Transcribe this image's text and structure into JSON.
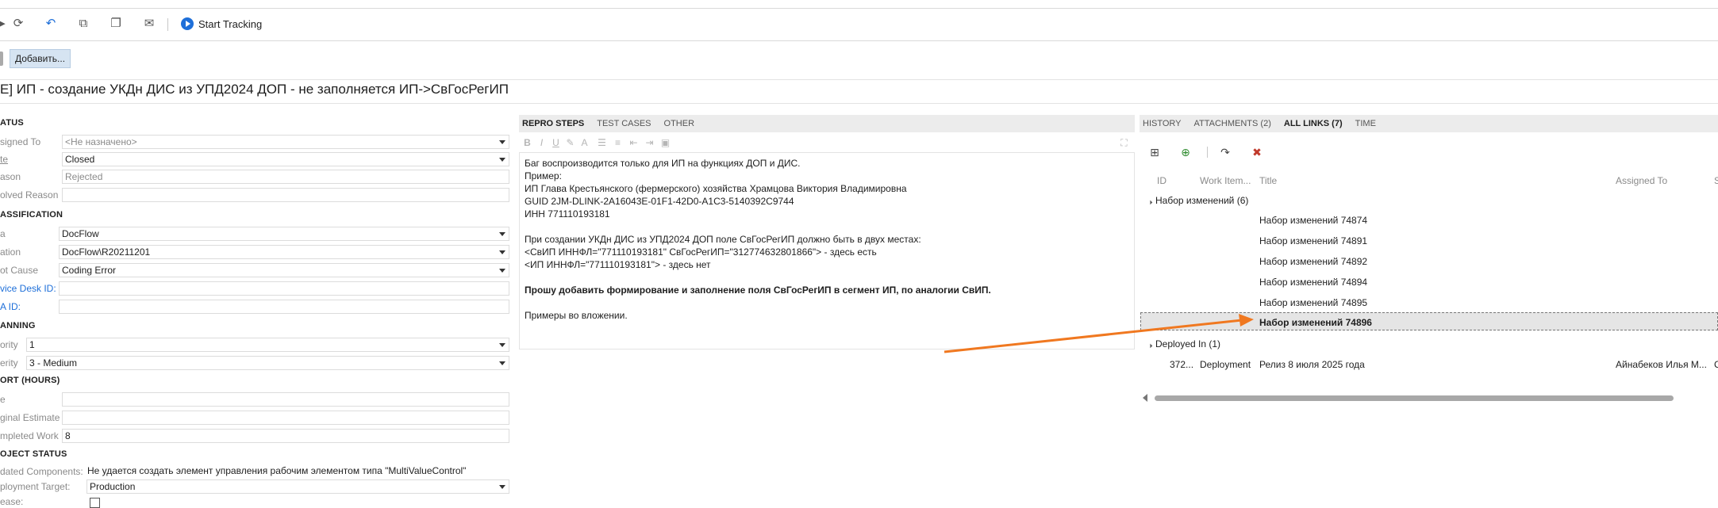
{
  "toolbar": {
    "icons": [
      "refresh-icon",
      "undo-icon",
      "copy-template-icon",
      "duplicate-icon",
      "mail-icon"
    ],
    "start_tracking": "Start Tracking"
  },
  "tags": {
    "add_label": "Добавить..."
  },
  "title": "E] ИП - создание УКДн ДИС из УПД2024 ДОП - не заполняется ИП->СвГосРегИП",
  "status": {
    "section": "ATUS",
    "assigned_label": "signed To",
    "assigned_value": "<Не назначено>",
    "state_label": "te",
    "state_value": "Closed",
    "reason_label": "ason",
    "reason_value": "Rejected",
    "resolved_label": "olved Reason",
    "resolved_value": ""
  },
  "classification": {
    "section": "ASSIFICATION",
    "area_label": "a",
    "area_value": "DocFlow",
    "iteration_label": "ation",
    "iteration_value": "DocFlow\\R20211201",
    "rootcause_label": "ot Cause",
    "rootcause_value": "Coding Error",
    "servicedesk_label": "vice Desk ID:",
    "servicedesk_value": "",
    "ra_label": "A ID:",
    "ra_value": ""
  },
  "planning": {
    "section": "ANNING",
    "priority_label": "ority",
    "priority_value": "1",
    "severity_label": "erity",
    "severity_value": "3 - Medium"
  },
  "effort": {
    "section": "ORT (HOURS)",
    "remaining_label": "e",
    "remaining_value": "",
    "original_label": "ginal Estimate",
    "original_value": "",
    "completed_label": "mpleted Work",
    "completed_value": "8"
  },
  "project_status": {
    "section": "OJECT STATUS",
    "components_label": "dated Components:",
    "components_value": "Не удается создать элемент управления рабочим элементом типа \"MultiValueControl\"",
    "deployment_label": "ployment Target:",
    "deployment_value": "Production",
    "checkbox_label": "ease:"
  },
  "middle_tabs": [
    "REPRO STEPS",
    "TEST CASES",
    "OTHER"
  ],
  "repro": {
    "lines": [
      "Баг воспроизводится только для ИП на функциях ДОП и ДИС.",
      "Пример:",
      "ИП Глава Крестьянского (фермерского) хозяйства Храмцова Виктория Владимировна",
      "GUID 2JM-DLINK-2A16043E-01F1-42D0-A1C3-5140392C9744",
      "ИНН 771110193181",
      "",
      "При создании УКДн ДИС из УПД2024 ДОП поле СвГосРегИП должно быть в двух местах:",
      "<СвИП ИННФЛ=\"771110193181\" СвГосРегИП=\"312774632801866\"> - здесь есть",
      "<ИП ИННФЛ=\"771110193181\"> - здесь нет",
      "",
      "Прошу добавить формирование и заполнение поля СвГосРегИП в сегмент ИП, по аналогии СвИП.",
      "",
      "Примеры во вложении."
    ],
    "bold_index": 10
  },
  "right_tabs": [
    "HISTORY",
    "ATTACHMENTS (2)",
    "ALL LINKS (7)",
    "TIME"
  ],
  "links": {
    "columns": {
      "id": "ID",
      "work_item": "Work Item...",
      "title": "Title",
      "assigned": "Assigned To",
      "state": "S"
    },
    "group1": "Набор изменений (6)",
    "changesets": [
      "Набор изменений 74874",
      "Набор изменений 74891",
      "Набор изменений 74892",
      "Набор изменений 74894",
      "Набор изменений 74895",
      "Набор изменений 74896"
    ],
    "group2": "Deployed In (1)",
    "deployed": {
      "id": "372...",
      "work_item": "Deployment",
      "title": "Релиз 8 июля 2025 года",
      "assigned": "Айнабеков Илья М...",
      "state": "C"
    }
  },
  "colors": {
    "accent": "#1e6fd9",
    "annotation_arrow": "#f07820",
    "tab_bar": "#ececec"
  }
}
